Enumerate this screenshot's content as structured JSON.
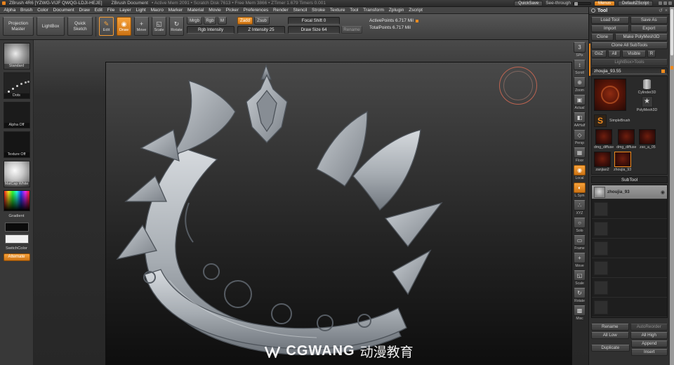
{
  "title_bar": {
    "app_title": "ZBrush 4R6 [YZWG-VIJF QWQG-LDJI-HEJE]",
    "doc_title": "ZBrush Document",
    "stats": "• Active Mem 2091 • Scratch Disk 7613 • Free Mem 3866 • ZTimer 1.679 Timers 0.001",
    "quicksave_label": "QuickSave",
    "see_through_label": "See-through",
    "menus_label": "Menus",
    "zscript_label": "DefaultZScript"
  },
  "menu_bar": {
    "items": [
      "Alpha",
      "Brush",
      "Color",
      "Document",
      "Draw",
      "Edit",
      "File",
      "Layer",
      "Light",
      "Macro",
      "Marker",
      "Material",
      "Movie",
      "Picker",
      "Preferences",
      "Render",
      "Stencil",
      "Stroke",
      "Texture",
      "Tool",
      "Transform",
      "Zplugin",
      "Zscript"
    ]
  },
  "top_shelf": {
    "projection_master": "Projection Master",
    "lightbox": "LightBox",
    "quick_sketch": "Quick Sketch",
    "edit": "Edit",
    "draw": "Draw",
    "move": "Move",
    "scale": "Scale",
    "rotate": "Rotate",
    "mrgb": "Mrgb",
    "rgb": "Rgb",
    "m": "M",
    "rgb_intensity": "Rgb Intensity",
    "zadd": "Zadd",
    "zsub": "Zsub",
    "z_intensity": "Z Intensity 25",
    "focal_shift": "Focal Shift 0",
    "draw_size": "Draw Size 64",
    "rename": "Rename",
    "active_points": "ActivePoints 6.717 Mil",
    "total_points": "TotalPoints 6.717 Mil"
  },
  "left_shelf": {
    "brush_label": "Standard",
    "stroke_label": "Dots",
    "alpha_label": "Alpha Off",
    "texture_label": "Texture Off",
    "material_label": "MatCap White",
    "gradient_label": "Gradient",
    "switch_label": "SwitchColor",
    "alternate_label": "Alternate"
  },
  "canvas": {
    "watermark_brand": "CGWANG",
    "watermark_cn": "动漫教育"
  },
  "right_shelf": {
    "spix_label": "SPix",
    "spix_value": "3",
    "items": [
      {
        "label": "Scroll",
        "glyph": "↕"
      },
      {
        "label": "Zoom",
        "glyph": "⊕"
      },
      {
        "label": "Actual",
        "glyph": "▣"
      },
      {
        "label": "AAHalf",
        "glyph": "◧"
      },
      {
        "label": "Persp",
        "glyph": "◇"
      },
      {
        "label": "Floor",
        "glyph": "▦"
      },
      {
        "label": "Local",
        "glyph": "◉"
      },
      {
        "label": "L.Sym",
        "glyph": "◐"
      },
      {
        "label": "XYZ",
        "glyph": "∴"
      },
      {
        "label": "Solo",
        "glyph": "○"
      },
      {
        "label": "Frame",
        "glyph": "▭"
      },
      {
        "label": "Move",
        "glyph": "+"
      },
      {
        "label": "Scale",
        "glyph": "◱"
      },
      {
        "label": "Rotate",
        "glyph": "↻"
      },
      {
        "label": "Misc",
        "glyph": "▩"
      }
    ]
  },
  "tool_panel": {
    "title": "Tool",
    "load_tool": "Load Tool",
    "save_as": "Save As",
    "import": "Import",
    "export": "Export",
    "clone": "Clone",
    "make_polymesh": "Make PolyMesh3D",
    "clone_all": "Clone All SubTools",
    "goz": "GoZ",
    "all": "All",
    "visible": "Visible",
    "r": "R",
    "lightbox_tools": "LightBox>Tools",
    "active_tool_name": "zhoujia_93.55",
    "thumbs": [
      {
        "label": "Cylinder3D"
      },
      {
        "label": "PolyMesh3D"
      },
      {
        "label": "SimpleBrush"
      },
      {
        "label": "dmg_diffuse"
      },
      {
        "label": "dmg_diffuse"
      },
      {
        "label": "zso_a_05"
      },
      {
        "label": "zanjiao2"
      },
      {
        "label": "zhoujia_93"
      }
    ],
    "subtool": {
      "title": "SubTool",
      "selected_name": "zhoujia_93",
      "rename": "Rename",
      "autoreorder": "AutoReorder",
      "all_low": "All Low",
      "all_high": "All High",
      "duplicate": "Duplicate",
      "append": "Append",
      "insert": "Insert"
    }
  }
}
